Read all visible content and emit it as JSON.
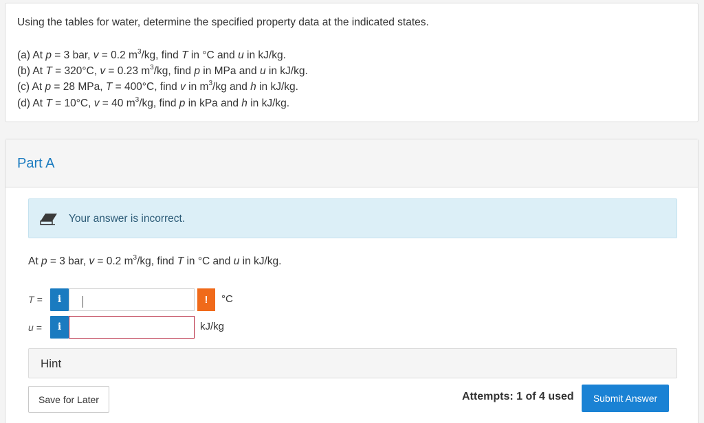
{
  "question": {
    "intro": "Using the tables for water, determine the specified property data at the indicated states.",
    "items": [
      {
        "label": "(a) At ",
        "p_var": "p",
        "p_rest": " = 3 bar, ",
        "v_var": "v",
        "v_rest": " = 0.2 m",
        "sup": "3",
        "tail1": "/kg, find ",
        "find1": "T",
        "mid": " in °C and ",
        "find2": "u",
        "end": " in kJ/kg."
      },
      {
        "label": "(b) At ",
        "p_var": "T",
        "p_rest": " = 320°C, ",
        "v_var": "v",
        "v_rest": " = 0.23 m",
        "sup": "3",
        "tail1": "/kg, find ",
        "find1": "p",
        "mid": " in MPa and ",
        "find2": "u",
        "end": " in kJ/kg."
      },
      {
        "label": "(c) At ",
        "p_var": "p",
        "p_rest": " = 28 MPa, ",
        "v_var": "T",
        "v_rest": " = 400°C, find ",
        "sup": "",
        "tail1": "",
        "find1": "v",
        "mid": " in m",
        "mid_sup": "3",
        "mid2": "/kg and ",
        "find2": "h",
        "end": " in kJ/kg."
      },
      {
        "label": "(d) At ",
        "p_var": "T",
        "p_rest": " = 10°C, ",
        "v_var": "v",
        "v_rest": " = 40 m",
        "sup": "3",
        "tail1": "/kg, find ",
        "find1": "p",
        "mid": " in kPa and ",
        "find2": "h",
        "end": " in kJ/kg."
      }
    ]
  },
  "part": {
    "title": "Part A",
    "feedback": "Your answer is incorrect.",
    "prompt_pre": "At ",
    "prompt_p": "p",
    "prompt_a": " = 3 bar, ",
    "prompt_v": "v",
    "prompt_b": " = 0.2 m",
    "prompt_sup": "3",
    "prompt_c": "/kg, find ",
    "prompt_T": "T",
    "prompt_d": " in °C and ",
    "prompt_u": "u",
    "prompt_e": " in kJ/kg."
  },
  "answers": {
    "t_label": "T =",
    "t_value": "",
    "t_unit": "°C",
    "u_label": "u =",
    "u_value": "",
    "u_unit": "kJ/kg",
    "info_glyph": "i",
    "warn_glyph": "!"
  },
  "hint": {
    "label": "Hint"
  },
  "footer": {
    "save_label": "Save for Later",
    "attempts": "Attempts: 1 of 4 used",
    "submit_label": "Submit Answer"
  },
  "colors": {
    "accent": "#1a7bc0",
    "submit": "#1a82d4",
    "warning": "#f06a1a",
    "error_border": "#b5223a",
    "feedback_bg": "#dceff7"
  }
}
